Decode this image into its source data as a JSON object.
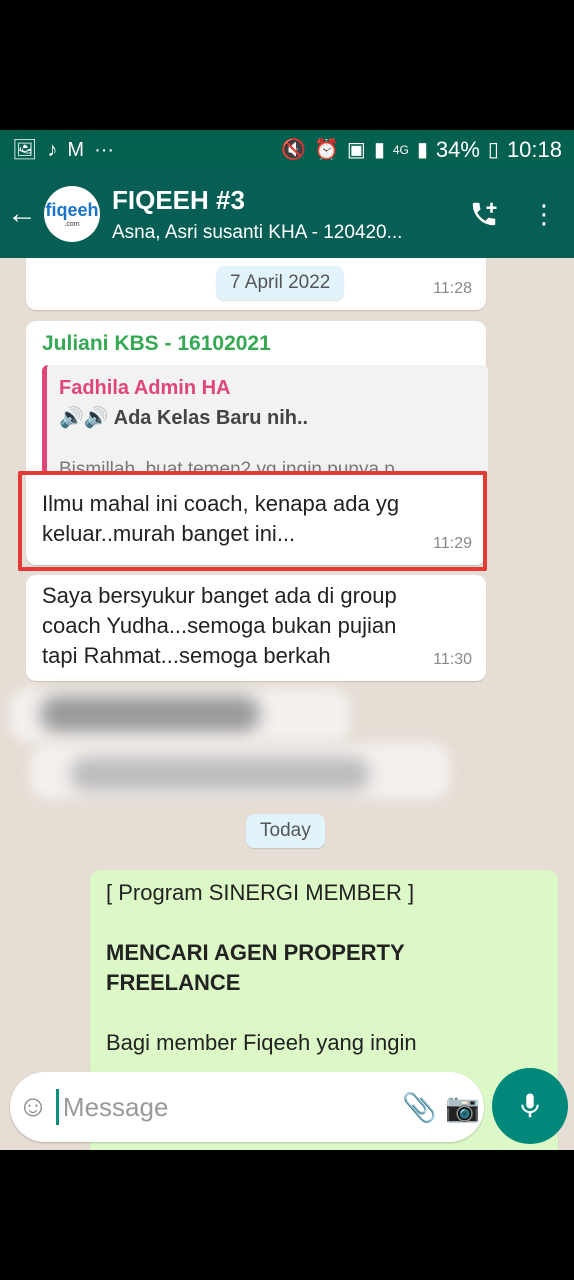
{
  "status_bar": {
    "left_icons": [
      "image-icon",
      "tiktok-icon",
      "gmail-icon",
      "more-dots-icon"
    ],
    "network": "4G",
    "battery": "34%",
    "time": "10:18"
  },
  "header": {
    "avatar_text": "fiqeeh",
    "avatar_sub": ".com",
    "title": "FIQEEH #3",
    "subtitle": "Asna, Asri susanti KHA - 120420..."
  },
  "chat": {
    "date_1": "7 April 2022",
    "msg_time_1": "11:28",
    "msg_2": {
      "sender": "Juliani KBS - 16102021",
      "quote_name": "Fadhila Admin HA",
      "quote_text": "🔊🔊 Ada Kelas Baru nih..",
      "quote_sub": "Bismillah, buat temen2 yg ingin punya p...",
      "text_line1": "Ilmu mahal ini coach, kenapa ada yg",
      "text_line2": "keluar..murah banget ini...",
      "time": "11:29"
    },
    "msg_3": {
      "line1": "Saya bersyukur  banget ada di group",
      "line2": "coach Yudha...semoga bukan pujian",
      "line3": "tapi Rahmat...semoga berkah",
      "time": "11:30"
    },
    "date_2": "Today",
    "out_msg": {
      "line1": "[ Program SINERGI MEMBER ]",
      "line2": "MENCARI AGEN PROPERTY",
      "line3": "FREELANCE",
      "line4": "Bagi member Fiqeeh yang ingin"
    }
  },
  "composer": {
    "placeholder": "Message"
  },
  "colors": {
    "header": "#075e54",
    "accent": "#00897b",
    "outgoing": "#dcf8c6",
    "highlight": "#e53935"
  }
}
